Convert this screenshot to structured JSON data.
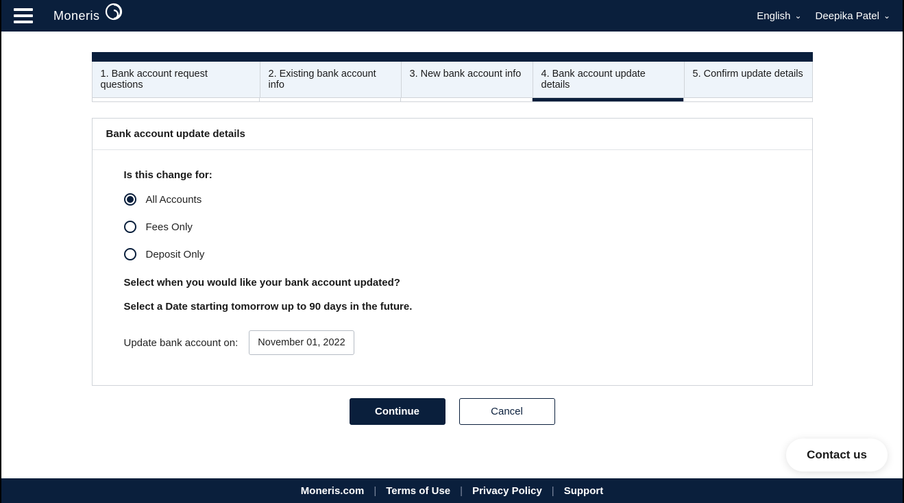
{
  "header": {
    "brand": "Moneris",
    "language": "English",
    "user": "Deepika Patel"
  },
  "tabs": [
    "1. Bank account request questions",
    "2. Existing bank account info",
    "3. New bank account info",
    "4. Bank account update details",
    "5. Confirm update details"
  ],
  "activeTabIndex": 3,
  "card": {
    "title": "Bank account update details",
    "question1": "Is this change for:",
    "options": [
      {
        "label": "All Accounts",
        "selected": true
      },
      {
        "label": "Fees Only",
        "selected": false
      },
      {
        "label": "Deposit Only",
        "selected": false
      }
    ],
    "question2a": "Select when you would like your bank account updated?",
    "question2b": "Select a Date starting tomorrow up to 90 days in the future.",
    "dateLabel": "Update bank account on:",
    "dateValue": "November 01, 2022"
  },
  "buttons": {
    "continue": "Continue",
    "cancel": "Cancel"
  },
  "contact": "Contact us",
  "footer": {
    "links": [
      "Moneris.com",
      "Terms of Use",
      "Privacy Policy",
      "Support"
    ]
  }
}
